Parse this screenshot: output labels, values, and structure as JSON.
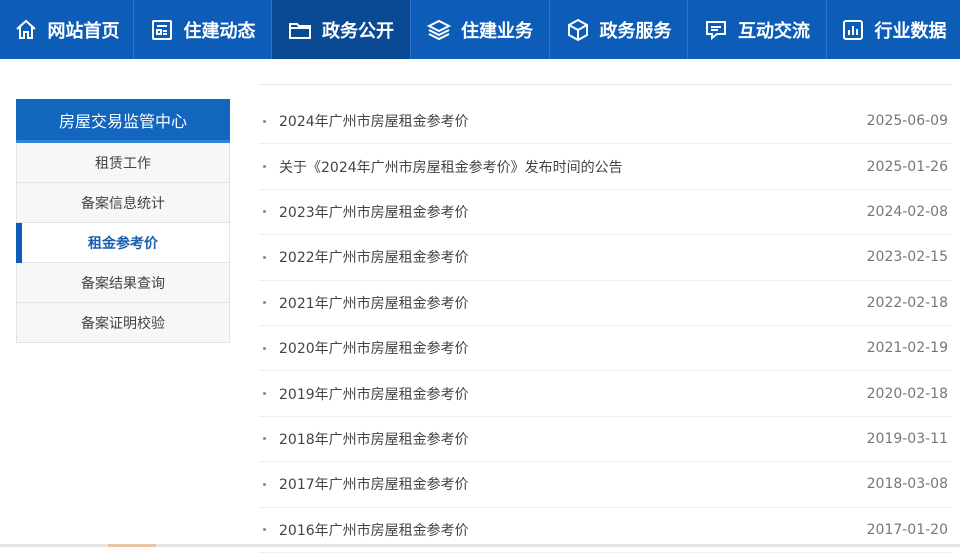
{
  "nav": {
    "items": [
      {
        "label": "网站首页",
        "icon": "home-icon"
      },
      {
        "label": "住建动态",
        "icon": "news-icon"
      },
      {
        "label": "政务公开",
        "icon": "folder-icon"
      },
      {
        "label": "住建业务",
        "icon": "layers-icon"
      },
      {
        "label": "政务服务",
        "icon": "box-icon"
      },
      {
        "label": "互动交流",
        "icon": "chat-icon"
      },
      {
        "label": "行业数据",
        "icon": "bar-chart-icon"
      }
    ],
    "active_index": 2
  },
  "sidebar": {
    "title": "房屋交易监管中心",
    "items": [
      {
        "label": "租赁工作"
      },
      {
        "label": "备案信息统计"
      },
      {
        "label": "租金参考价"
      },
      {
        "label": "备案结果查询"
      },
      {
        "label": "备案证明校验"
      }
    ],
    "active_index": 2
  },
  "articles": [
    {
      "title": "2024年广州市房屋租金参考价",
      "date": "2025-06-09"
    },
    {
      "title": "关于《2024年广州市房屋租金参考价》发布时间的公告",
      "date": "2025-01-26"
    },
    {
      "title": "2023年广州市房屋租金参考价",
      "date": "2024-02-08"
    },
    {
      "title": "2022年广州市房屋租金参考价",
      "date": "2023-02-15"
    },
    {
      "title": "2021年广州市房屋租金参考价",
      "date": "2022-02-18"
    },
    {
      "title": "2020年广州市房屋租金参考价",
      "date": "2021-02-19"
    },
    {
      "title": "2019年广州市房屋租金参考价",
      "date": "2020-02-18"
    },
    {
      "title": "2018年广州市房屋租金参考价",
      "date": "2019-03-11"
    },
    {
      "title": "2017年广州市房屋租金参考价",
      "date": "2018-03-08"
    },
    {
      "title": "2016年广州市房屋租金参考价",
      "date": "2017-01-20"
    }
  ],
  "colors": {
    "nav_bg": "#0d5db8",
    "nav_active_bg": "#0a4a94",
    "accent": "#1266bd"
  }
}
